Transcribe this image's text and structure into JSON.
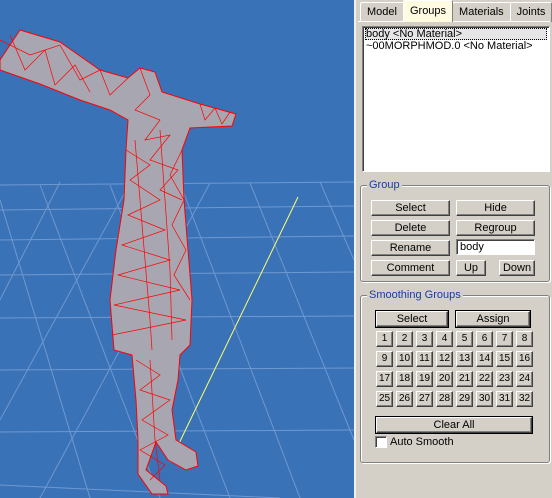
{
  "tabs": [
    {
      "label": "Model",
      "active": false
    },
    {
      "label": "Groups",
      "active": true
    },
    {
      "label": "Materials",
      "active": false
    },
    {
      "label": "Joints",
      "active": false
    }
  ],
  "groups_list": [
    "body <No Material>",
    "~00MORPHMOD.0 <No Material>"
  ],
  "group_box": {
    "title": "Group",
    "select_label": "Select",
    "hide_label": "Hide",
    "delete_label": "Delete",
    "regroup_label": "Regroup",
    "rename_label": "Rename",
    "name_value": "body",
    "comment_label": "Comment",
    "up_label": "Up",
    "down_label": "Down"
  },
  "smoothing_box": {
    "title": "Smoothing Groups",
    "select_label": "Select",
    "assign_label": "Assign",
    "numbers": [
      "1",
      "2",
      "3",
      "4",
      "5",
      "6",
      "7",
      "8",
      "9",
      "10",
      "11",
      "12",
      "13",
      "14",
      "15",
      "16",
      "17",
      "18",
      "19",
      "20",
      "21",
      "22",
      "23",
      "24",
      "25",
      "26",
      "27",
      "28",
      "29",
      "30",
      "31",
      "32"
    ],
    "clear_all_label": "Clear All",
    "auto_smooth_label": "Auto Smooth",
    "auto_smooth_checked": false
  },
  "colors": {
    "viewport_bg": "#3a72b8",
    "wireframe": "#ff0000",
    "group_title": "#1a3aa8",
    "axis_line": "#ffff66"
  }
}
